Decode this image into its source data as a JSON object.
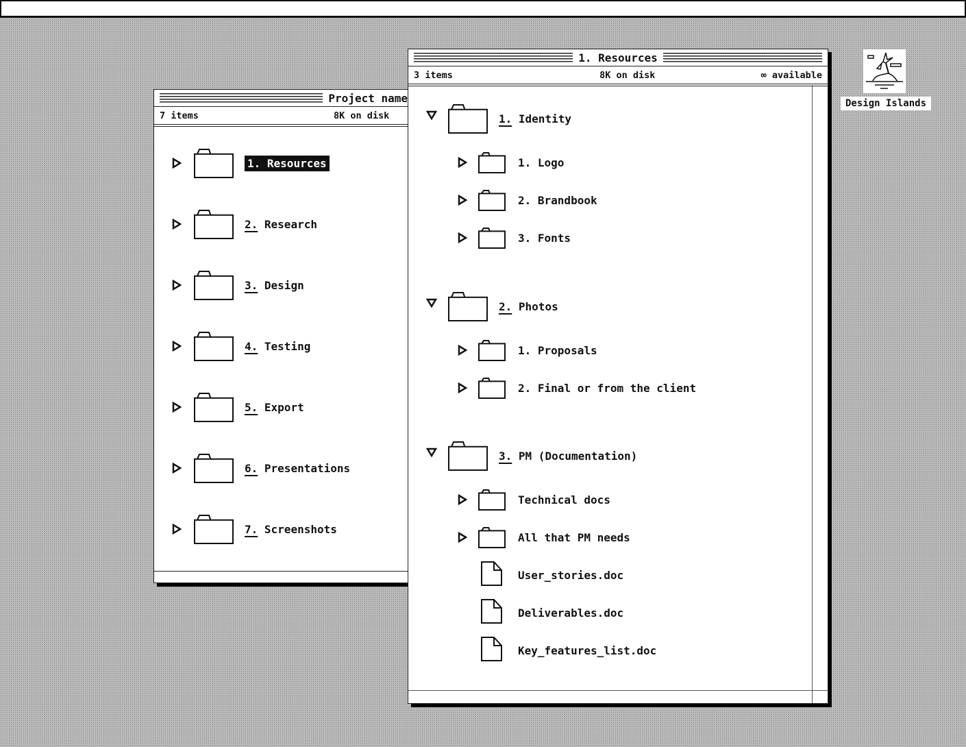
{
  "menubar": {},
  "desktop": {
    "icon_label": "Design Islands",
    "icon_name": "island-icon"
  },
  "project_window": {
    "title": "Project name",
    "info": {
      "items": "7 items",
      "disk": "8K on disk"
    },
    "items": [
      {
        "num": "1.",
        "name": "Resources",
        "selected": true
      },
      {
        "num": "2.",
        "name": "Research",
        "selected": false
      },
      {
        "num": "3.",
        "name": "Design",
        "selected": false
      },
      {
        "num": "4.",
        "name": "Testing",
        "selected": false
      },
      {
        "num": "5.",
        "name": "Export",
        "selected": false
      },
      {
        "num": "6.",
        "name": "Presentations",
        "selected": false
      },
      {
        "num": "7.",
        "name": "Screenshots",
        "selected": false
      }
    ]
  },
  "resources_window": {
    "title": "1. Resources",
    "info": {
      "items": "3 items",
      "disk": "8K on disk",
      "available": "∞ available"
    },
    "groups": [
      {
        "num": "1.",
        "name": "Identity",
        "expanded": true,
        "children": [
          {
            "type": "folder",
            "label": "1. Logo"
          },
          {
            "type": "folder",
            "label": "2. Brandbook"
          },
          {
            "type": "folder",
            "label": "3. Fonts"
          }
        ]
      },
      {
        "num": "2.",
        "name": "Photos",
        "expanded": true,
        "children": [
          {
            "type": "folder",
            "label": "1. Proposals"
          },
          {
            "type": "folder",
            "label": "2. Final or from the client"
          }
        ]
      },
      {
        "num": "3.",
        "name": "PM (Documentation)",
        "expanded": true,
        "children": [
          {
            "type": "folder",
            "label": "Technical docs"
          },
          {
            "type": "folder",
            "label": "All that PM needs"
          },
          {
            "type": "file",
            "label": "User_stories.doc"
          },
          {
            "type": "file",
            "label": "Deliverables.doc"
          },
          {
            "type": "file",
            "label": "Key_features_list.doc"
          }
        ]
      }
    ]
  }
}
